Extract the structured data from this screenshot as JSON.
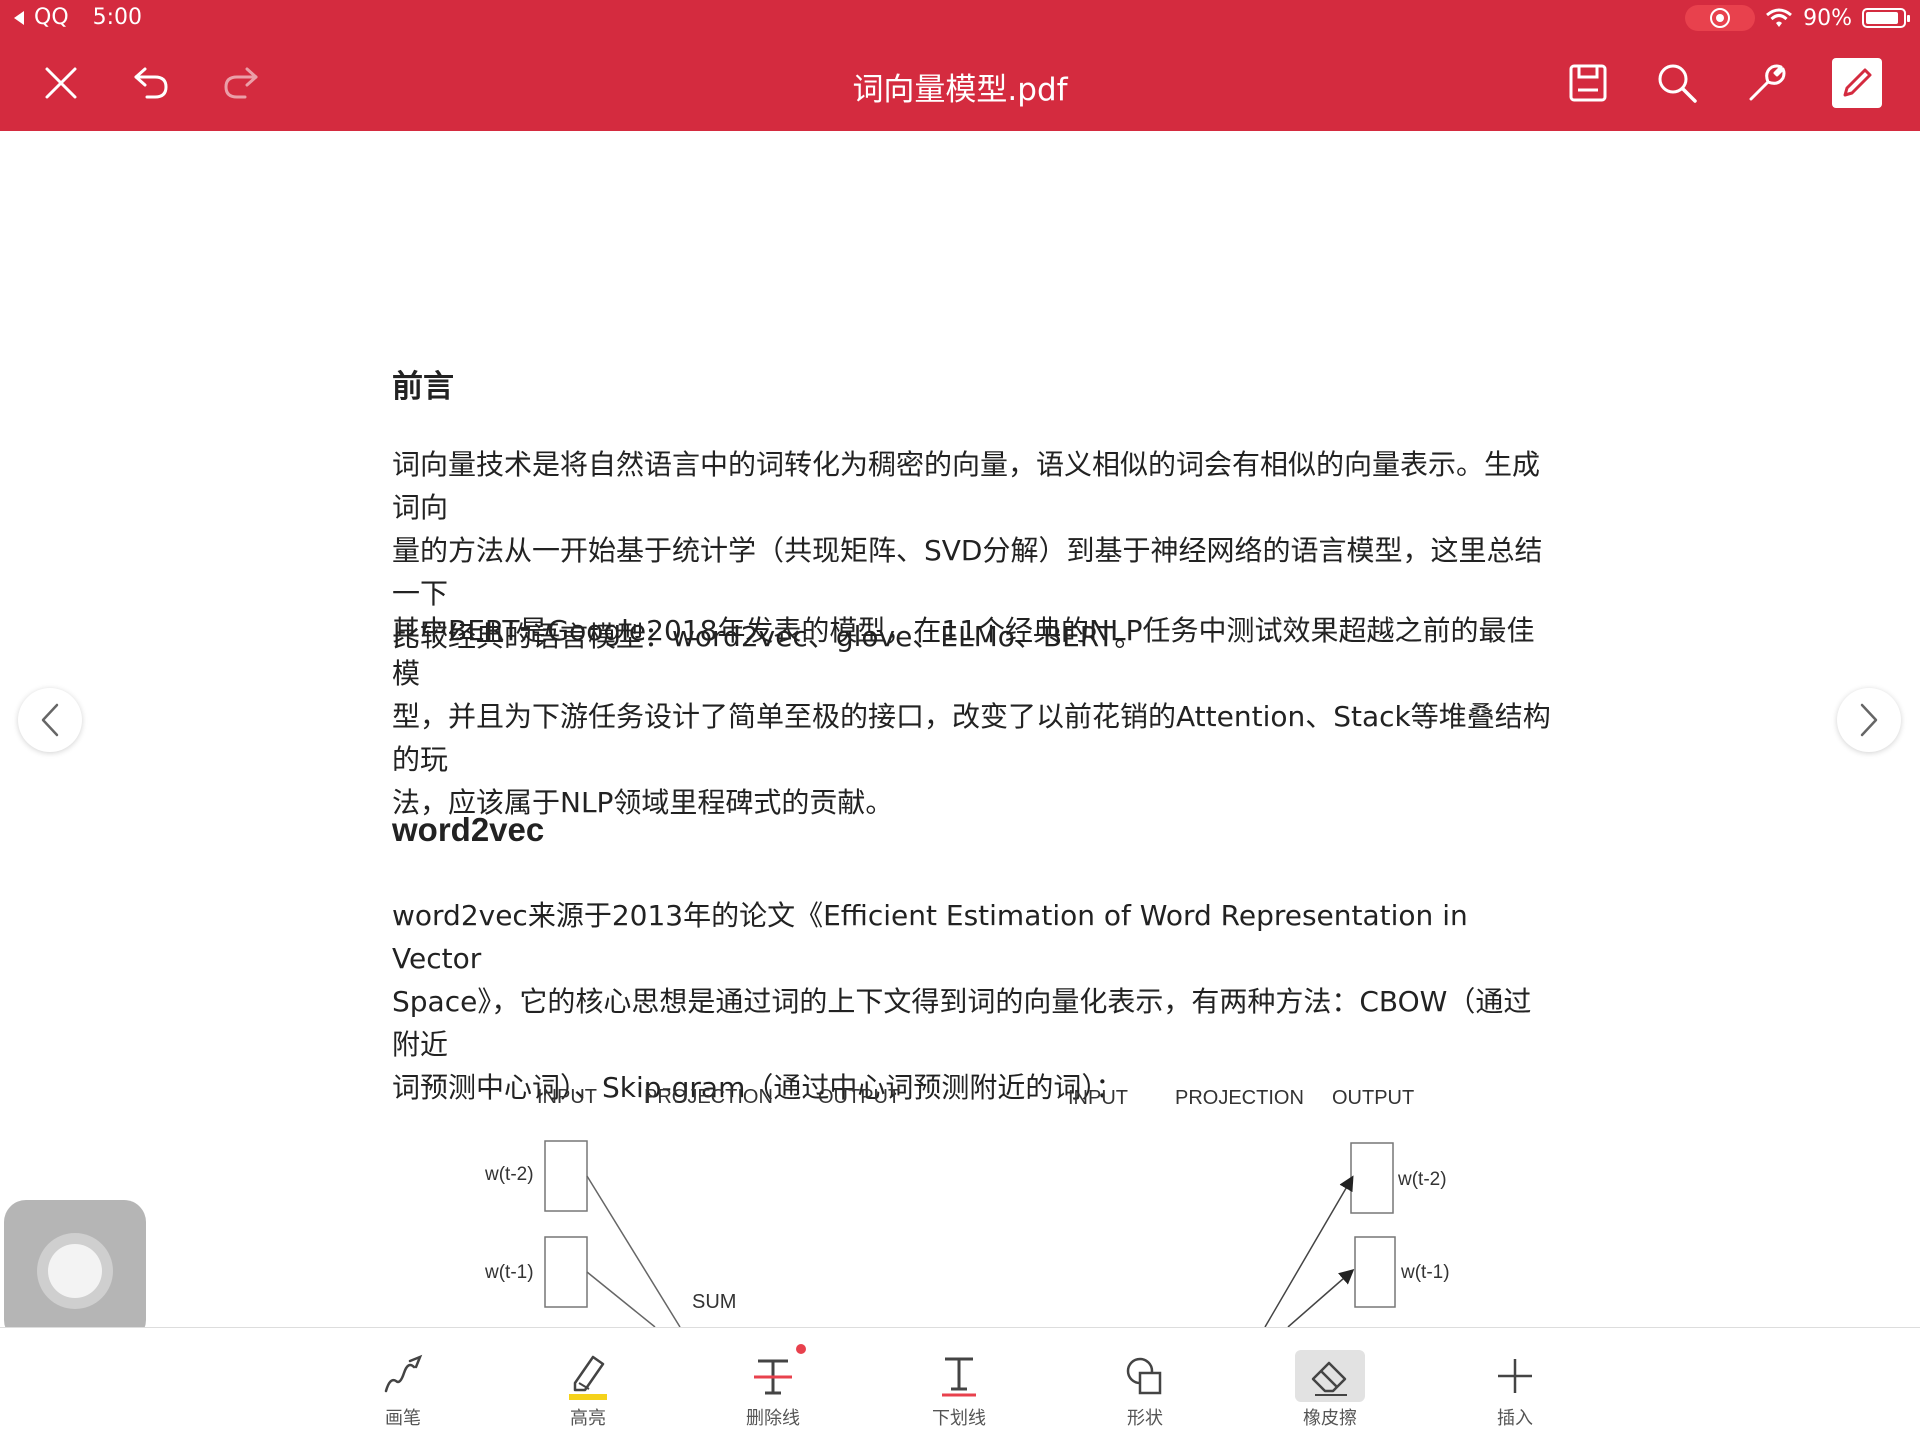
{
  "status_bar": {
    "back_app": "QQ",
    "time": "5:00",
    "battery_percent": "90%",
    "battery_level": 0.9
  },
  "toolbar": {
    "title": "词向量模型.pdf"
  },
  "document": {
    "heading_preface": "前言",
    "preface_p1_l1": "词向量技术是将自然语言中的词转化为稠密的向量，语义相似的词会有相似的向量表示。生成词向",
    "preface_p1_l2": "量的方法从一开始基于统计学（共现矩阵、SVD分解）到基于神经网络的语言模型，这里总结一下",
    "preface_p1_l3": "比较经典的语言模型：word2vec、glove、ELMo、BERT。",
    "preface_p2_l1": "其中BERT是Google2018年发表的模型，在11个经典的NLP任务中测试效果超越之前的最佳模",
    "preface_p2_l2": "型，并且为下游任务设计了简单至极的接口，改变了以前花销的Attention、Stack等堆叠结构的玩",
    "preface_p2_l3": "法，应该属于NLP领域里程碑式的贡献。",
    "heading_word2vec": "word2vec",
    "w2v_l1": "word2vec来源于2013年的论文《Efficient Estimation of Word Representation in Vector",
    "w2v_l2": "Space》，它的核心思想是通过词的上下文得到词的向量化表示，有两种方法：CBOW（通过附近",
    "w2v_l3": "词预测中心词）、Skip-gram（通过中心词预测附近的词）："
  },
  "figure": {
    "left": {
      "input": "INPUT",
      "projection": "PROJECTION",
      "output": "OUTPUT",
      "w_t_minus_2": "w(t-2)",
      "w_t_minus_1": "w(t-1)",
      "sum": "SUM"
    },
    "right": {
      "input": "INPUT",
      "projection": "PROJECTION",
      "output": "OUTPUT",
      "w_t_minus_2": "w(t-2)",
      "w_t_minus_1": "w(t-1)"
    }
  },
  "bottom_tools": [
    {
      "label": "画笔",
      "icon": "pen-icon"
    },
    {
      "label": "高亮",
      "icon": "highlighter-icon"
    },
    {
      "label": "删除线",
      "icon": "strikethrough-icon"
    },
    {
      "label": "下划线",
      "icon": "underline-icon"
    },
    {
      "label": "形状",
      "icon": "shape-icon"
    },
    {
      "label": "橡皮擦",
      "icon": "eraser-icon"
    },
    {
      "label": "插入",
      "icon": "plus-icon"
    }
  ],
  "colors": {
    "accent": "#d42b3f",
    "highlight_yellow": "#f5d21a",
    "strike_red": "#e8414d"
  }
}
